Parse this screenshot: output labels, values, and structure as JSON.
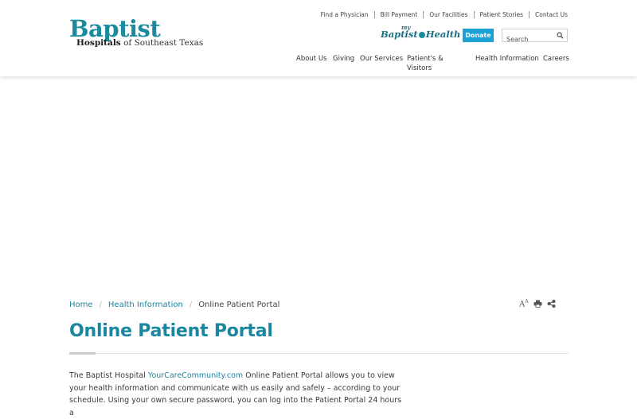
{
  "logo": {
    "main": "Baptist",
    "sub_bold": "Hospitals",
    "sub_rest": " of Southeast Texas"
  },
  "utility_nav": [
    "Find a Physician",
    "Bill Payment",
    "Our Facilities",
    "Patient Stories",
    "Contact Us"
  ],
  "mybaptisthealth": {
    "my": "my",
    "baptist": "Baptist",
    "health": "Health"
  },
  "donate_label": "Donate",
  "search": {
    "placeholder": "Search"
  },
  "main_nav": [
    "About Us",
    "Giving",
    "Our Services",
    "Patient's &",
    "Visitors",
    "Health Information",
    "Careers"
  ],
  "breadcrumb": {
    "home": "Home",
    "section": "Health Information",
    "current": "Online Patient Portal",
    "separator": "/"
  },
  "tools": {
    "text_size_glyph": "A",
    "text_size_sup": "A"
  },
  "page_title": "Online Patient Portal",
  "body": {
    "part1": "The Baptist Hospital ",
    "link": "YourCareCommunity.com",
    "part2": " Online Patient Portal allows you to view your health information and communicate with us easily and safely – according to your schedule. Using your own secure password, you can log into the Patient Portal 24 hours a"
  },
  "colors": {
    "brand_teal": "#1a86a0",
    "donate_blue": "#1aa1d6"
  }
}
